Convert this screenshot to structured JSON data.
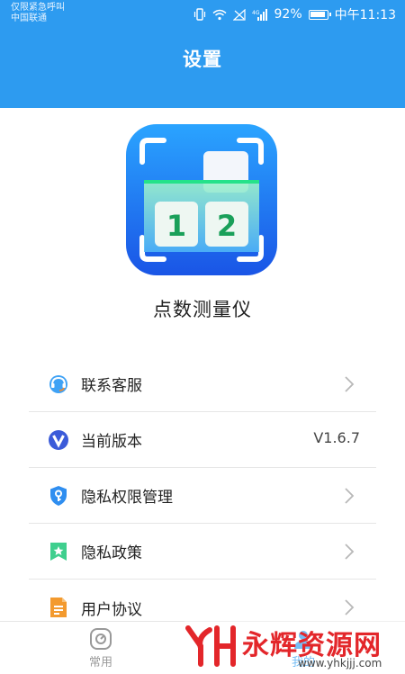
{
  "status_bar": {
    "line1": "仅限紧急呼叫",
    "line2": "中国联通",
    "battery": "92%",
    "time": "中午11:13"
  },
  "header": {
    "title": "设置"
  },
  "app": {
    "name": "点数测量仪",
    "logo_digits": [
      "1",
      "2"
    ]
  },
  "menu": {
    "items": [
      {
        "label": "联系客服",
        "icon": "headset-icon"
      },
      {
        "label": "当前版本",
        "icon": "version-v-icon",
        "value": "V1.6.7"
      },
      {
        "label": "隐私权限管理",
        "icon": "shield-key-icon"
      },
      {
        "label": "隐私政策",
        "icon": "bookmark-star-icon"
      },
      {
        "label": "用户协议",
        "icon": "document-icon"
      }
    ]
  },
  "tabbar": {
    "tabs": [
      {
        "label": "常用",
        "icon": "common-icon"
      },
      {
        "label": "我的",
        "icon": "mine-icon"
      }
    ]
  },
  "watermark": {
    "text": "永辉资源网",
    "url": "www.yhkjjj.com"
  },
  "colors": {
    "primary": "#2d9bf0",
    "watermark_red": "#e3262a"
  }
}
